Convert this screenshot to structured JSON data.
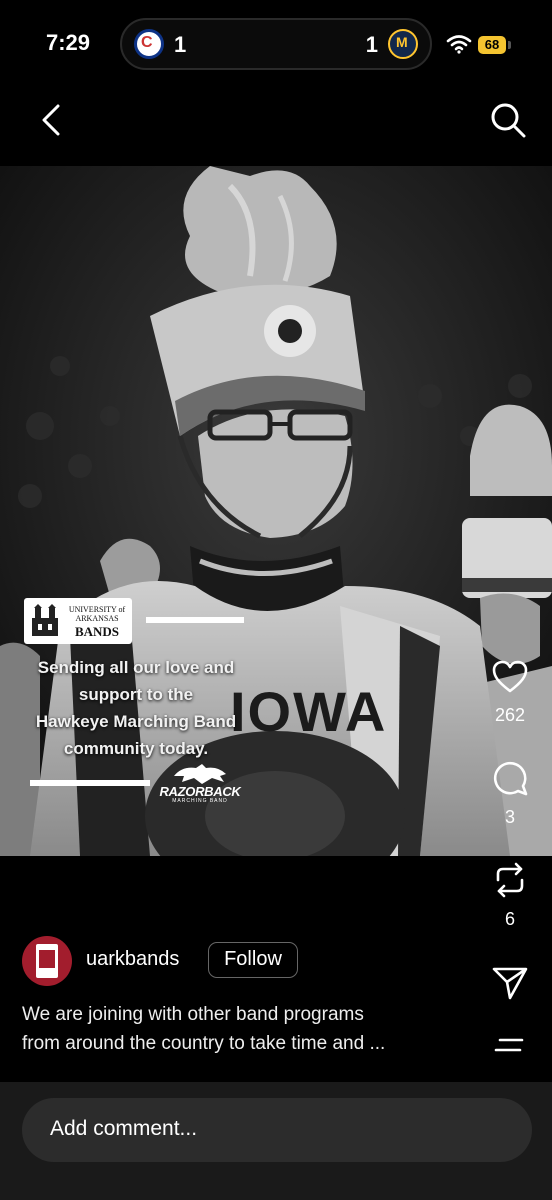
{
  "status_bar": {
    "time": "7:29",
    "live_activity": {
      "left_team_icon": "cubs-logo",
      "left_score": "1",
      "right_score": "1",
      "right_team_icon": "brewers-logo"
    },
    "battery": "68"
  },
  "nav": {
    "back_icon": "chevron-left-icon",
    "search_icon": "search-icon"
  },
  "post_graphic": {
    "logo_line1": "UNIVERSITY of ARKANSAS",
    "logo_line2": "BANDS",
    "message_lines": [
      "Sending all our love and",
      "support to the",
      "Hawkeye Marching Band",
      "community today."
    ],
    "razorback_title": "RAZORBACK",
    "razorback_subtitle": "MARCHING BAND",
    "uniform_text": "IOWA"
  },
  "actions": {
    "likes": "262",
    "comments": "3",
    "reposts": "6"
  },
  "author": {
    "username": "uarkbands",
    "follow_label": "Follow"
  },
  "caption": [
    "We are joining with other band programs",
    "from around the country to take time and ..."
  ],
  "comment_bar": {
    "placeholder": "Add comment..."
  }
}
